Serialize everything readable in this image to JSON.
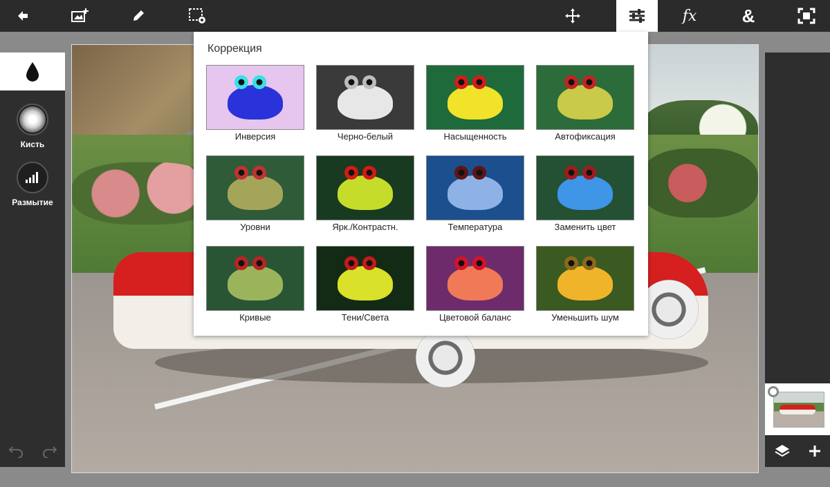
{
  "toolbar": {
    "icons": [
      "back-arrow-icon",
      "add-image-icon",
      "pencil-icon",
      "selection-settings-icon",
      "move-icon",
      "adjustments-icon",
      "fx-icon",
      "ampersand-icon",
      "fit-screen-icon"
    ],
    "fx_label": "fx",
    "amp_label": "&",
    "active": "adjustments-icon"
  },
  "left_panel": {
    "tools": [
      {
        "name": "drop-icon",
        "label": ""
      },
      {
        "name": "brush-icon",
        "label": "Кисть"
      },
      {
        "name": "blur-bars-icon",
        "label": "Размытие"
      }
    ]
  },
  "popup": {
    "title": "Коррекция",
    "items": [
      {
        "label": "Инверсия",
        "bg": "#e6c6ee",
        "frog": "#2a32d9",
        "eye": "#37e0e8"
      },
      {
        "label": "Черно-белый",
        "bg": "#3a3a3a",
        "frog": "#e7e7e7",
        "eye": "#bdbdbd"
      },
      {
        "label": "Насыщенность",
        "bg": "#1f6a3a",
        "frog": "#f1e22a",
        "eye": "#d41c1c"
      },
      {
        "label": "Автофиксация",
        "bg": "#2b6c3a",
        "frog": "#c9c94a",
        "eye": "#c22323"
      },
      {
        "label": "Уровни",
        "bg": "#2f5b39",
        "frog": "#a5a55a",
        "eye": "#c23131"
      },
      {
        "label": "Ярк./Контрастн.",
        "bg": "#183a20",
        "frog": "#c5dd2a",
        "eye": "#d11b14"
      },
      {
        "label": "Температура",
        "bg": "#1b4f8e",
        "frog": "#8fb2e6",
        "eye": "#5d1515"
      },
      {
        "label": "Заменить цвет",
        "bg": "#245033",
        "frog": "#3f95e6",
        "eye": "#a21b1b"
      },
      {
        "label": "Кривые",
        "bg": "#2a5535",
        "frog": "#9bb45b",
        "eye": "#b82424"
      },
      {
        "label": "Тени/Света",
        "bg": "#132a14",
        "frog": "#d9e12a",
        "eye": "#c41a1a"
      },
      {
        "label": "Цветовой баланс",
        "bg": "#6d2b6b",
        "frog": "#f07a58",
        "eye": "#d4122a"
      },
      {
        "label": "Уменьшить шум",
        "bg": "#3a5a22",
        "frog": "#f0b42a",
        "eye": "#8a6a1a"
      }
    ]
  },
  "right_panel": {
    "icons": [
      "layers-icon",
      "plus-icon"
    ]
  }
}
